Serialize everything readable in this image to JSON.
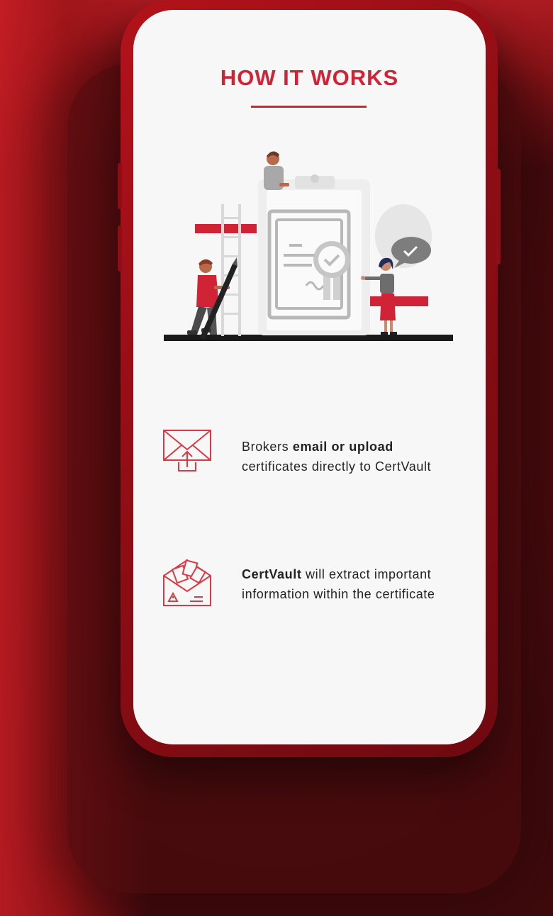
{
  "header": {
    "title": "HOW IT WORKS"
  },
  "colors": {
    "accent": "#d02436",
    "screen_bg": "#f7f7f7",
    "phone": "#9e1017"
  },
  "steps": [
    {
      "icon": "email-upload-icon",
      "pre": "Brokers ",
      "bold": "email or upload",
      "post": "certificates directly to CertVault"
    },
    {
      "icon": "envelope-documents-warning-icon",
      "pre": "",
      "bold": "CertVault",
      "post": " will extract important information within the certificate"
    }
  ]
}
